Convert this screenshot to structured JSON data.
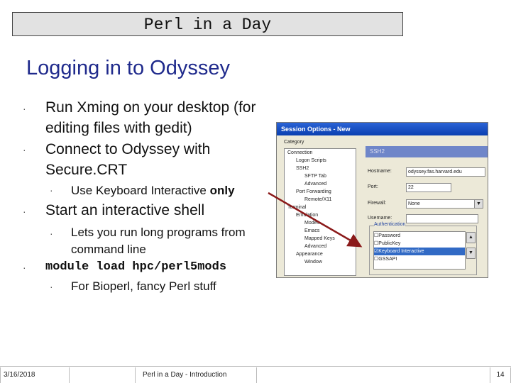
{
  "slide": {
    "title": "Perl in a Day",
    "heading": "Logging in to Odyssey",
    "bullets": {
      "xming": "Run Xming on your desktop (for editing files with gedit)",
      "connect_line1": "Connect to Odyssey with",
      "connect_line2": "Secure.CRT",
      "keyboard_prefix": "Use Keyboard Interactive",
      "keyboard_bold": "only",
      "shell": "Start an interactive shell",
      "long_programs": "Lets you run long programs from command line",
      "module_cmd": "module load hpc/perl5mods",
      "bioperl": "For Bioperl, fancy Perl stuff"
    },
    "bullet_glyph": "·"
  },
  "screenshot": {
    "window_title": "Session Options - New",
    "category_label": "Category",
    "tree": [
      "Connection",
      "Logon Scripts",
      "SSH2",
      "SFTP Tab",
      "Advanced",
      "Port Forwarding",
      "Remote/X11",
      "Terminal",
      "Emulation",
      "Modes",
      "Emacs",
      "Mapped Keys",
      "Advanced",
      "Appearance",
      "Window"
    ],
    "section_title": "SSH2",
    "fields": {
      "hostname_label": "Hostname:",
      "hostname_value": "odyssey.fas.harvard.edu",
      "port_label": "Port:",
      "port_value": "22",
      "firewall_label": "Firewall:",
      "firewall_value": "None",
      "username_label": "Username:",
      "username_value": ""
    },
    "authentication": {
      "legend": "Authentication",
      "items": [
        "Password",
        "PublicKey",
        "Keyboard Interactive",
        "GSSAPI"
      ],
      "selected_index": 2,
      "checked": [
        false,
        false,
        true,
        false
      ]
    }
  },
  "footer": {
    "date": "3/16/2018",
    "center": "Perl in a Day - Introduction",
    "page": "14"
  },
  "colors": {
    "heading": "#1f2a8c",
    "arrow": "#8b1a1a",
    "title_bg": "#e2e2e2"
  }
}
